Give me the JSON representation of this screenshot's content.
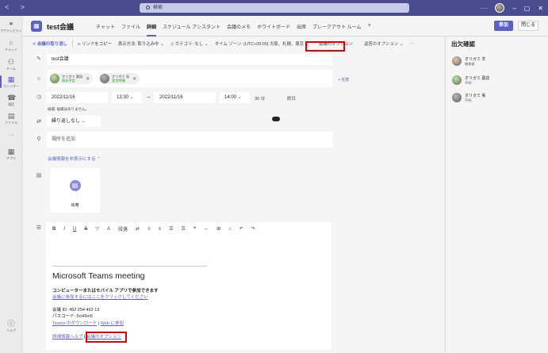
{
  "titlebar": {
    "search_placeholder": "検索",
    "nav_arrows": "< >",
    "menu_glyph": "···",
    "minimize_glyph": "–",
    "maximize_glyph": "▢",
    "close_glyph": "✕"
  },
  "rail": [
    {
      "label": "アクティビティ",
      "icon": "bell-icon"
    },
    {
      "label": "チャット",
      "icon": "chat-icon"
    },
    {
      "label": "チーム",
      "icon": "teams-icon"
    },
    {
      "label": "カレンダー",
      "icon": "calendar-icon"
    },
    {
      "label": "通話",
      "icon": "phone-icon"
    },
    {
      "label": "ファイル",
      "icon": "file-icon"
    },
    {
      "label": "···",
      "icon": "more-icon"
    },
    {
      "label": "アプリ",
      "icon": "apps-icon"
    },
    {
      "label": "ヘルプ",
      "icon": "help-icon"
    }
  ],
  "header": {
    "title": "test会議",
    "tabs": [
      "チャット",
      "ファイル",
      "詳細",
      "スケジュール アシスタント",
      "会議のメモ",
      "ホワイトボード",
      "出席",
      "ブレークアウト ルーム"
    ],
    "plus": "+",
    "join_label": "参加",
    "close_label": "閉じる"
  },
  "toolbar": {
    "cancel": "会議の取り消し",
    "copy_link": "リンクをコピー",
    "show_as": "表示方法: 取り込み中",
    "category": "カテゴリ: なし",
    "timezone": "タイム ゾーン: (UTC+09:00) 大阪、札幌、東京",
    "meeting_options": "会議のオプション",
    "reply_options": "返答のオプション",
    "more": "···"
  },
  "form": {
    "title_value": "test会議",
    "attendees": [
      {
        "name": "オリガミ 葉誌",
        "status": "既存予定"
      },
      {
        "name": "オリガミ 兎",
        "status": "宣言時間"
      }
    ],
    "optional": "+ 任意",
    "start_date": "2022/11/16",
    "start_time": "13:30",
    "end_date": "2022/11/16",
    "end_time": "14:00",
    "duration": "30 分",
    "all_day": "終日",
    "suggestion": "候補: 候補はありません。",
    "repeat": "繰り返しなし",
    "location_placeholder": "場所を追加",
    "hide_details": "会議情報を非表示にする",
    "attendance_label": "出席"
  },
  "editor": {
    "tools": [
      "B",
      "I",
      "U",
      "S",
      "▽",
      "A",
      "段落",
      "⇄",
      "≡",
      "≡",
      "☰",
      "☰",
      "❝",
      "⇔",
      "⊞",
      "⌂",
      "↶",
      "↷"
    ],
    "heading": "Microsoft Teams meeting",
    "join_prompt": "コンピューターまたはモバイル アプリで参加できます",
    "join_link": "会議に参加するにはここをクリックしてください",
    "meeting_id": "会議 ID: 492 254 492 13",
    "passcode": "パスコード: 5cH5m5",
    "download_link": "Teams のダウンロード",
    "separator": "|",
    "web_link": "Web に参加",
    "help_link": "詳細情報ヘルプ",
    "options_link": "会議のオプション"
  },
  "attendance": {
    "title": "出欠確認",
    "people": [
      {
        "name": "オリガミ 羊",
        "status": "開催者"
      },
      {
        "name": "オリガミ 葉誌",
        "status": "不明"
      },
      {
        "name": "オリガミ 兎",
        "status": "不明"
      }
    ]
  },
  "colors": {
    "brand": "#5b5fc7",
    "titlebar": "#4b4c90",
    "highlight": "#e00000"
  }
}
